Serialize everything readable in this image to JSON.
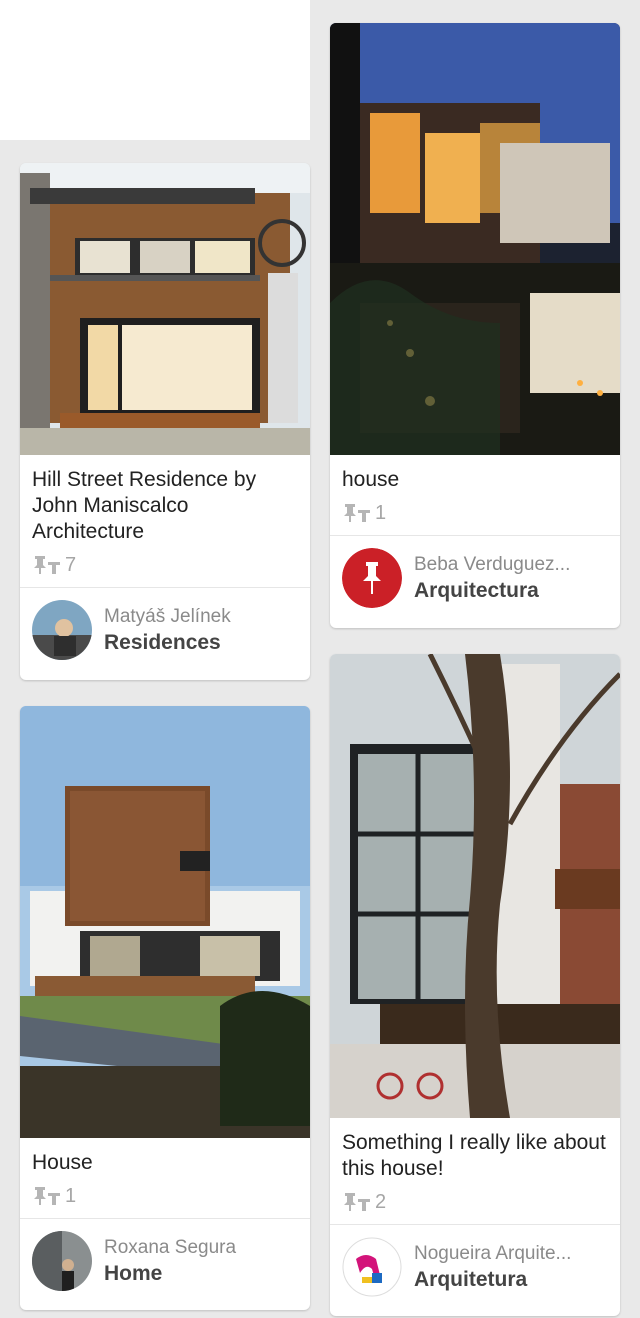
{
  "pins": [
    {
      "description": "Hill Street Residence by John Maniscalco Architecture",
      "repin_count": "7",
      "pinner": "Matyáš Jelínek",
      "board": "Residences",
      "image_icon": "house-photo-icon",
      "avatar_icon": "user-avatar-icon"
    },
    {
      "description": "house",
      "repin_count": "1",
      "pinner": "Beba Verduguez...",
      "board": "Arquitectura",
      "image_icon": "house-night-photo-icon",
      "avatar_icon": "pinterest-pin-avatar-icon"
    },
    {
      "description": "House",
      "repin_count": "1",
      "pinner": "Roxana Segura",
      "board": "Home",
      "image_icon": "modern-house-photo-icon",
      "avatar_icon": "user-avatar-icon"
    },
    {
      "description": "Something I really like about this house!",
      "repin_count": "2",
      "pinner": "Nogueira Arquite...",
      "board": "Arquitetura",
      "image_icon": "townhouse-photo-icon",
      "avatar_icon": "brand-logo-avatar-icon"
    }
  ],
  "colors": {
    "background": "#e9e9e9",
    "card": "#ffffff",
    "repin_gray": "#a6a6a6",
    "pinterest_red": "#cb2027"
  }
}
